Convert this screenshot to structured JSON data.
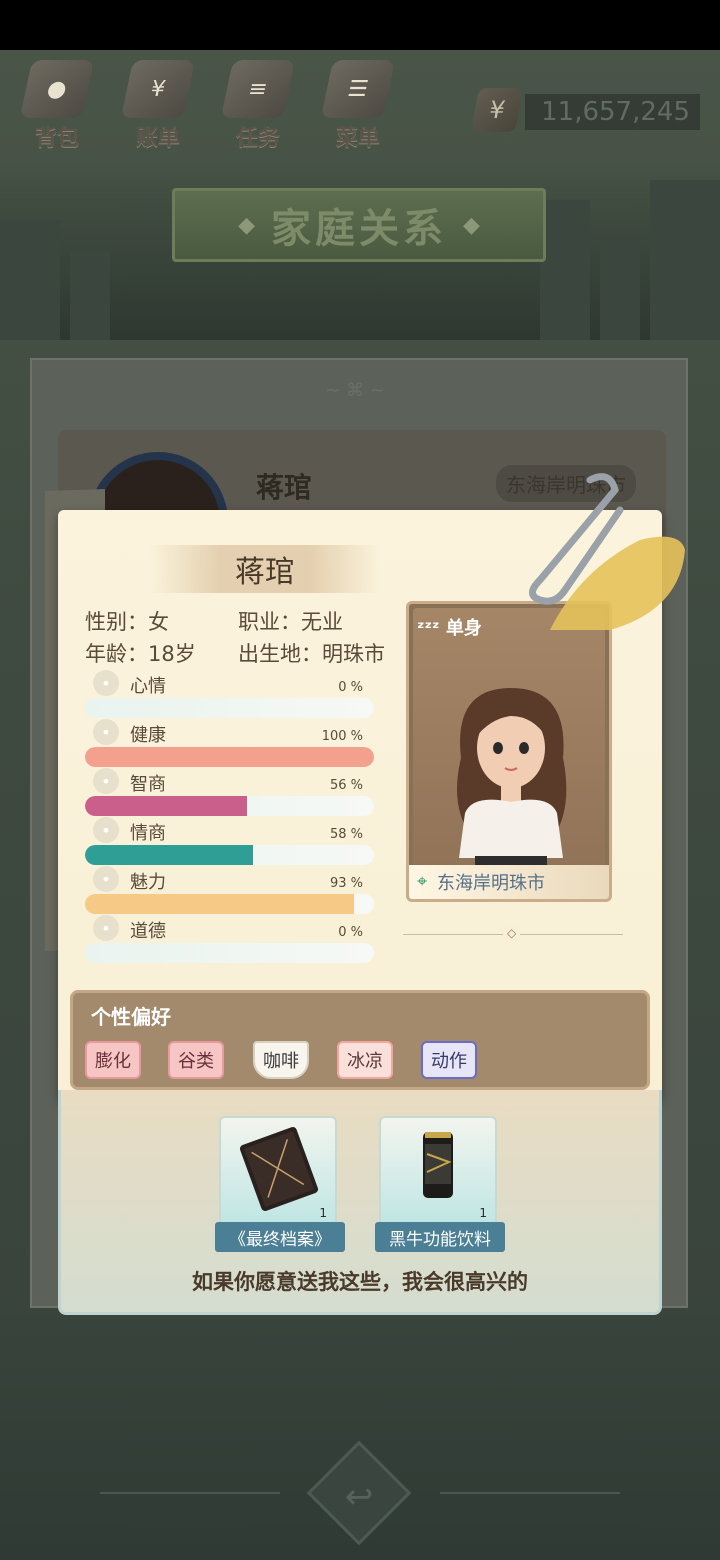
{
  "topnav": {
    "items": [
      {
        "label": "背包",
        "icon": "backpack-icon"
      },
      {
        "label": "账单",
        "icon": "bill-icon"
      },
      {
        "label": "任务",
        "icon": "task-icon"
      },
      {
        "label": "菜单",
        "icon": "menu-icon"
      }
    ],
    "money": {
      "currency": "¥",
      "value": "11,657,245"
    }
  },
  "title": "家庭关系",
  "back_card": {
    "name": "蒋琯",
    "location": "东海岸明珠市"
  },
  "profile": {
    "name": "蒋琯",
    "gender_label": "性别：女",
    "job_label": "职业：无业",
    "age_label": "年龄：18岁",
    "birthplace_label": "出生地：明珠市",
    "relationship_status": "单身",
    "location": "东海岸明珠市",
    "stats": [
      {
        "label": "心情",
        "value": "0 %",
        "fraction": 0.0,
        "color": "#f5b68c",
        "icon": "smile-icon"
      },
      {
        "label": "健康",
        "value": "100 %",
        "fraction": 1.0,
        "color": "#f3a08e",
        "icon": "heart-icon"
      },
      {
        "label": "智商",
        "value": "56 %",
        "fraction": 0.56,
        "color": "#c95f8a",
        "icon": "bulb-icon"
      },
      {
        "label": "情商",
        "value": "58 %",
        "fraction": 0.58,
        "color": "#2f9f95",
        "icon": "apple-icon"
      },
      {
        "label": "魅力",
        "value": "93 %",
        "fraction": 0.93,
        "color": "#f6c986",
        "icon": "sparkle-icon"
      },
      {
        "label": "道德",
        "value": "0 %",
        "fraction": 0.0,
        "color": "#9fd0c8",
        "icon": "scale-icon"
      }
    ]
  },
  "preferences": {
    "title": "个性偏好",
    "tags": [
      "膨化",
      "谷类",
      "咖啡",
      "冰凉",
      "动作"
    ]
  },
  "gifts": {
    "items": [
      {
        "name": "《最终档案》",
        "count": "1",
        "icon": "book-icon"
      },
      {
        "name": "黑牛功能饮料",
        "count": "1",
        "icon": "can-icon"
      }
    ],
    "message": "如果你愿意送我这些，我会很高兴的"
  }
}
